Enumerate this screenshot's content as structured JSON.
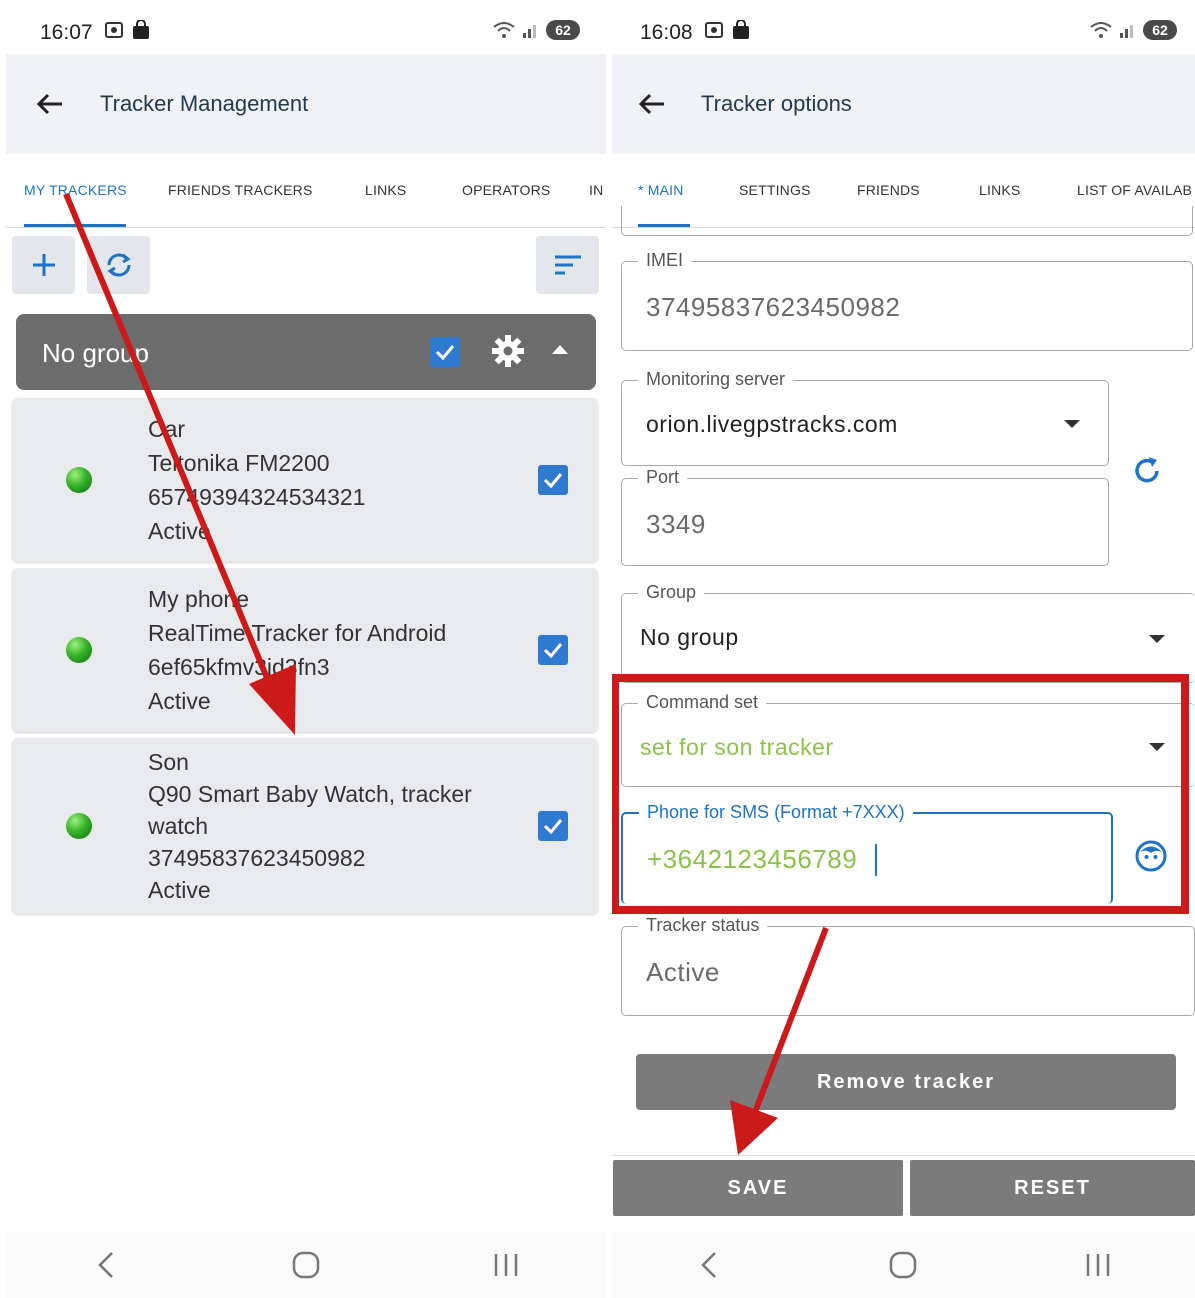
{
  "left": {
    "status": {
      "time": "16:07",
      "battery": "62"
    },
    "title": "Tracker Management",
    "tabs": [
      "MY TRACKERS",
      "FRIENDS TRACKERS",
      "LINKS",
      "OPERATORS",
      "IN"
    ],
    "group": {
      "label": "No group",
      "checked": true
    },
    "trackers": [
      {
        "name": "Car",
        "model": "Teltonika FM2200",
        "id": "65749394324534321",
        "status": "Active",
        "checked": true
      },
      {
        "name": "My phone",
        "model": "RealTime Tracker for Android",
        "id": "6ef65kfmv3jd3fn3",
        "status": "Active",
        "checked": true
      },
      {
        "name": "Son",
        "model": "Q90 Smart Baby Watch, tracker",
        "model2": "watch",
        "id": "37495837623450982",
        "status": "Active",
        "checked": true
      }
    ]
  },
  "right": {
    "status": {
      "time": "16:08",
      "battery": "62"
    },
    "title": "Tracker options",
    "tabs": [
      "* MAIN",
      "SETTINGS",
      "FRIENDS",
      "LINKS",
      "LIST OF AVAILAB"
    ],
    "fields": {
      "imei": {
        "label": "IMEI",
        "value": "37495837623450982"
      },
      "server": {
        "label": "Monitoring server",
        "value": "orion.livegpstracks.com"
      },
      "port": {
        "label": "Port",
        "value": "3349"
      },
      "group": {
        "label": "Group",
        "value": "No group"
      },
      "command_set": {
        "label": "Command set",
        "value": "set for son tracker"
      },
      "phone": {
        "label": "Phone for SMS (Format +7XXX)",
        "value": "+3642123456789"
      },
      "tracker_status": {
        "label": "Tracker status",
        "value": "Active"
      }
    },
    "buttons": {
      "remove": "Remove tracker",
      "save": "SAVE",
      "reset": "RESET"
    }
  },
  "colors": {
    "accent": "#1e73c8",
    "highlight": "#cc1a1a",
    "green_text": "#8bc34a",
    "button_gray": "#7b7b7b"
  },
  "icons": [
    "back-arrow-icon",
    "add-icon",
    "sync-icon",
    "sort-icon",
    "gear-icon",
    "refresh-icon",
    "contact-icon",
    "nav-back-icon",
    "nav-home-icon",
    "nav-recents-icon"
  ]
}
